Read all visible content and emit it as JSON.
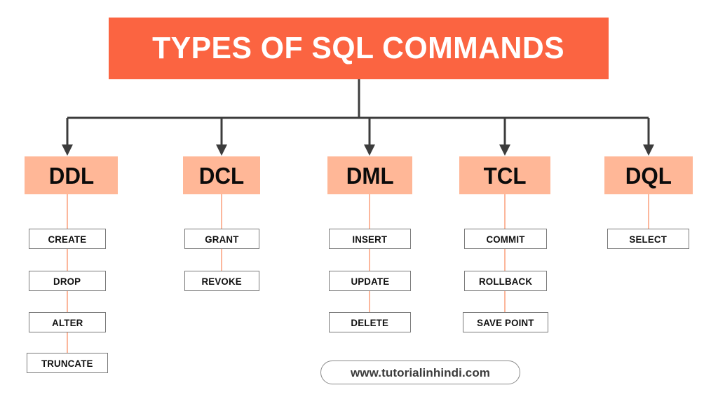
{
  "title": {
    "text": "TYPES OF SQL COMMANDS",
    "background_color": "#fb6441",
    "text_color": "#ffffff"
  },
  "colors": {
    "banner_orange": "#fb6441",
    "category_peach": "#ffb797",
    "connector_dark": "#3c3c3c",
    "connector_salmon": "#fcb79c",
    "leaf_border_gray": "#7a7a7a",
    "footer_border_gray": "#8a8a8a",
    "footer_text_gray": "#3b3b3b",
    "page_background": "#ffffff"
  },
  "chart_data": {
    "type": "diagram",
    "title": "TYPES OF SQL COMMANDS",
    "root": "TYPES OF SQL COMMANDS",
    "categories": [
      {
        "name": "DDL",
        "commands": [
          "CREATE",
          "DROP",
          "ALTER",
          "TRUNCATE"
        ]
      },
      {
        "name": "DCL",
        "commands": [
          "GRANT",
          "REVOKE"
        ]
      },
      {
        "name": "DML",
        "commands": [
          "INSERT",
          "UPDATE",
          "DELETE"
        ]
      },
      {
        "name": "TCL",
        "commands": [
          "COMMIT",
          "ROLLBACK",
          "SAVE POINT"
        ]
      },
      {
        "name": "DQL",
        "commands": [
          "SELECT"
        ]
      }
    ]
  },
  "footer": {
    "url": "www.tutorialinhindi.com"
  }
}
